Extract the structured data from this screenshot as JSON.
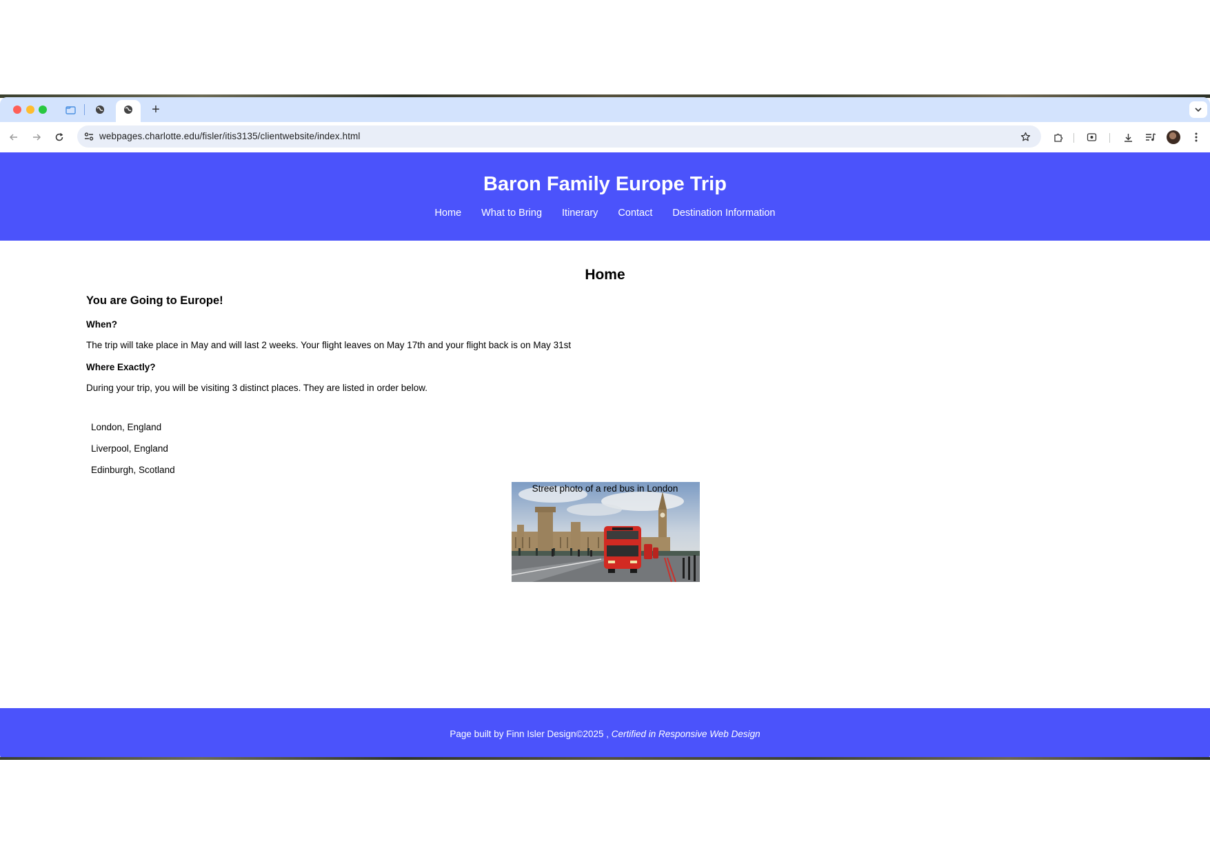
{
  "browser": {
    "url": "webpages.charlotte.edu/fisler/itis3135/clientwebsite/index.html",
    "tabs": [
      {
        "icon": "folder-tab-icon"
      },
      {
        "icon": "globe-icon"
      },
      {
        "icon": "globe-icon",
        "active": true
      }
    ],
    "accent_color": "#d3e3fd"
  },
  "site": {
    "title": "Baron Family Europe Trip",
    "nav": [
      "Home",
      "What to Bring",
      "Itinerary",
      "Contact",
      "Destination Information"
    ],
    "header_color": "#4b53fb"
  },
  "main": {
    "heading": "Home",
    "intro_heading": "You are Going to Europe!",
    "when_heading": "When?",
    "when_text": "The trip will take place in May and will last 2 weeks. Your flight leaves on May 17th and your flight back is on May 31st",
    "where_heading": "Where Exactly?",
    "where_text": "During your trip, you will be visiting 3 distinct places. They are listed in order below.",
    "destinations": [
      "London, England",
      "Liverpool, England",
      "Edinburgh, Scotland"
    ],
    "caption": "Street photo of a red bus in London"
  },
  "footer": {
    "text": "Page built by Finn Isler Design©2025 , ",
    "certification": "Certified in Responsive Web Design"
  }
}
